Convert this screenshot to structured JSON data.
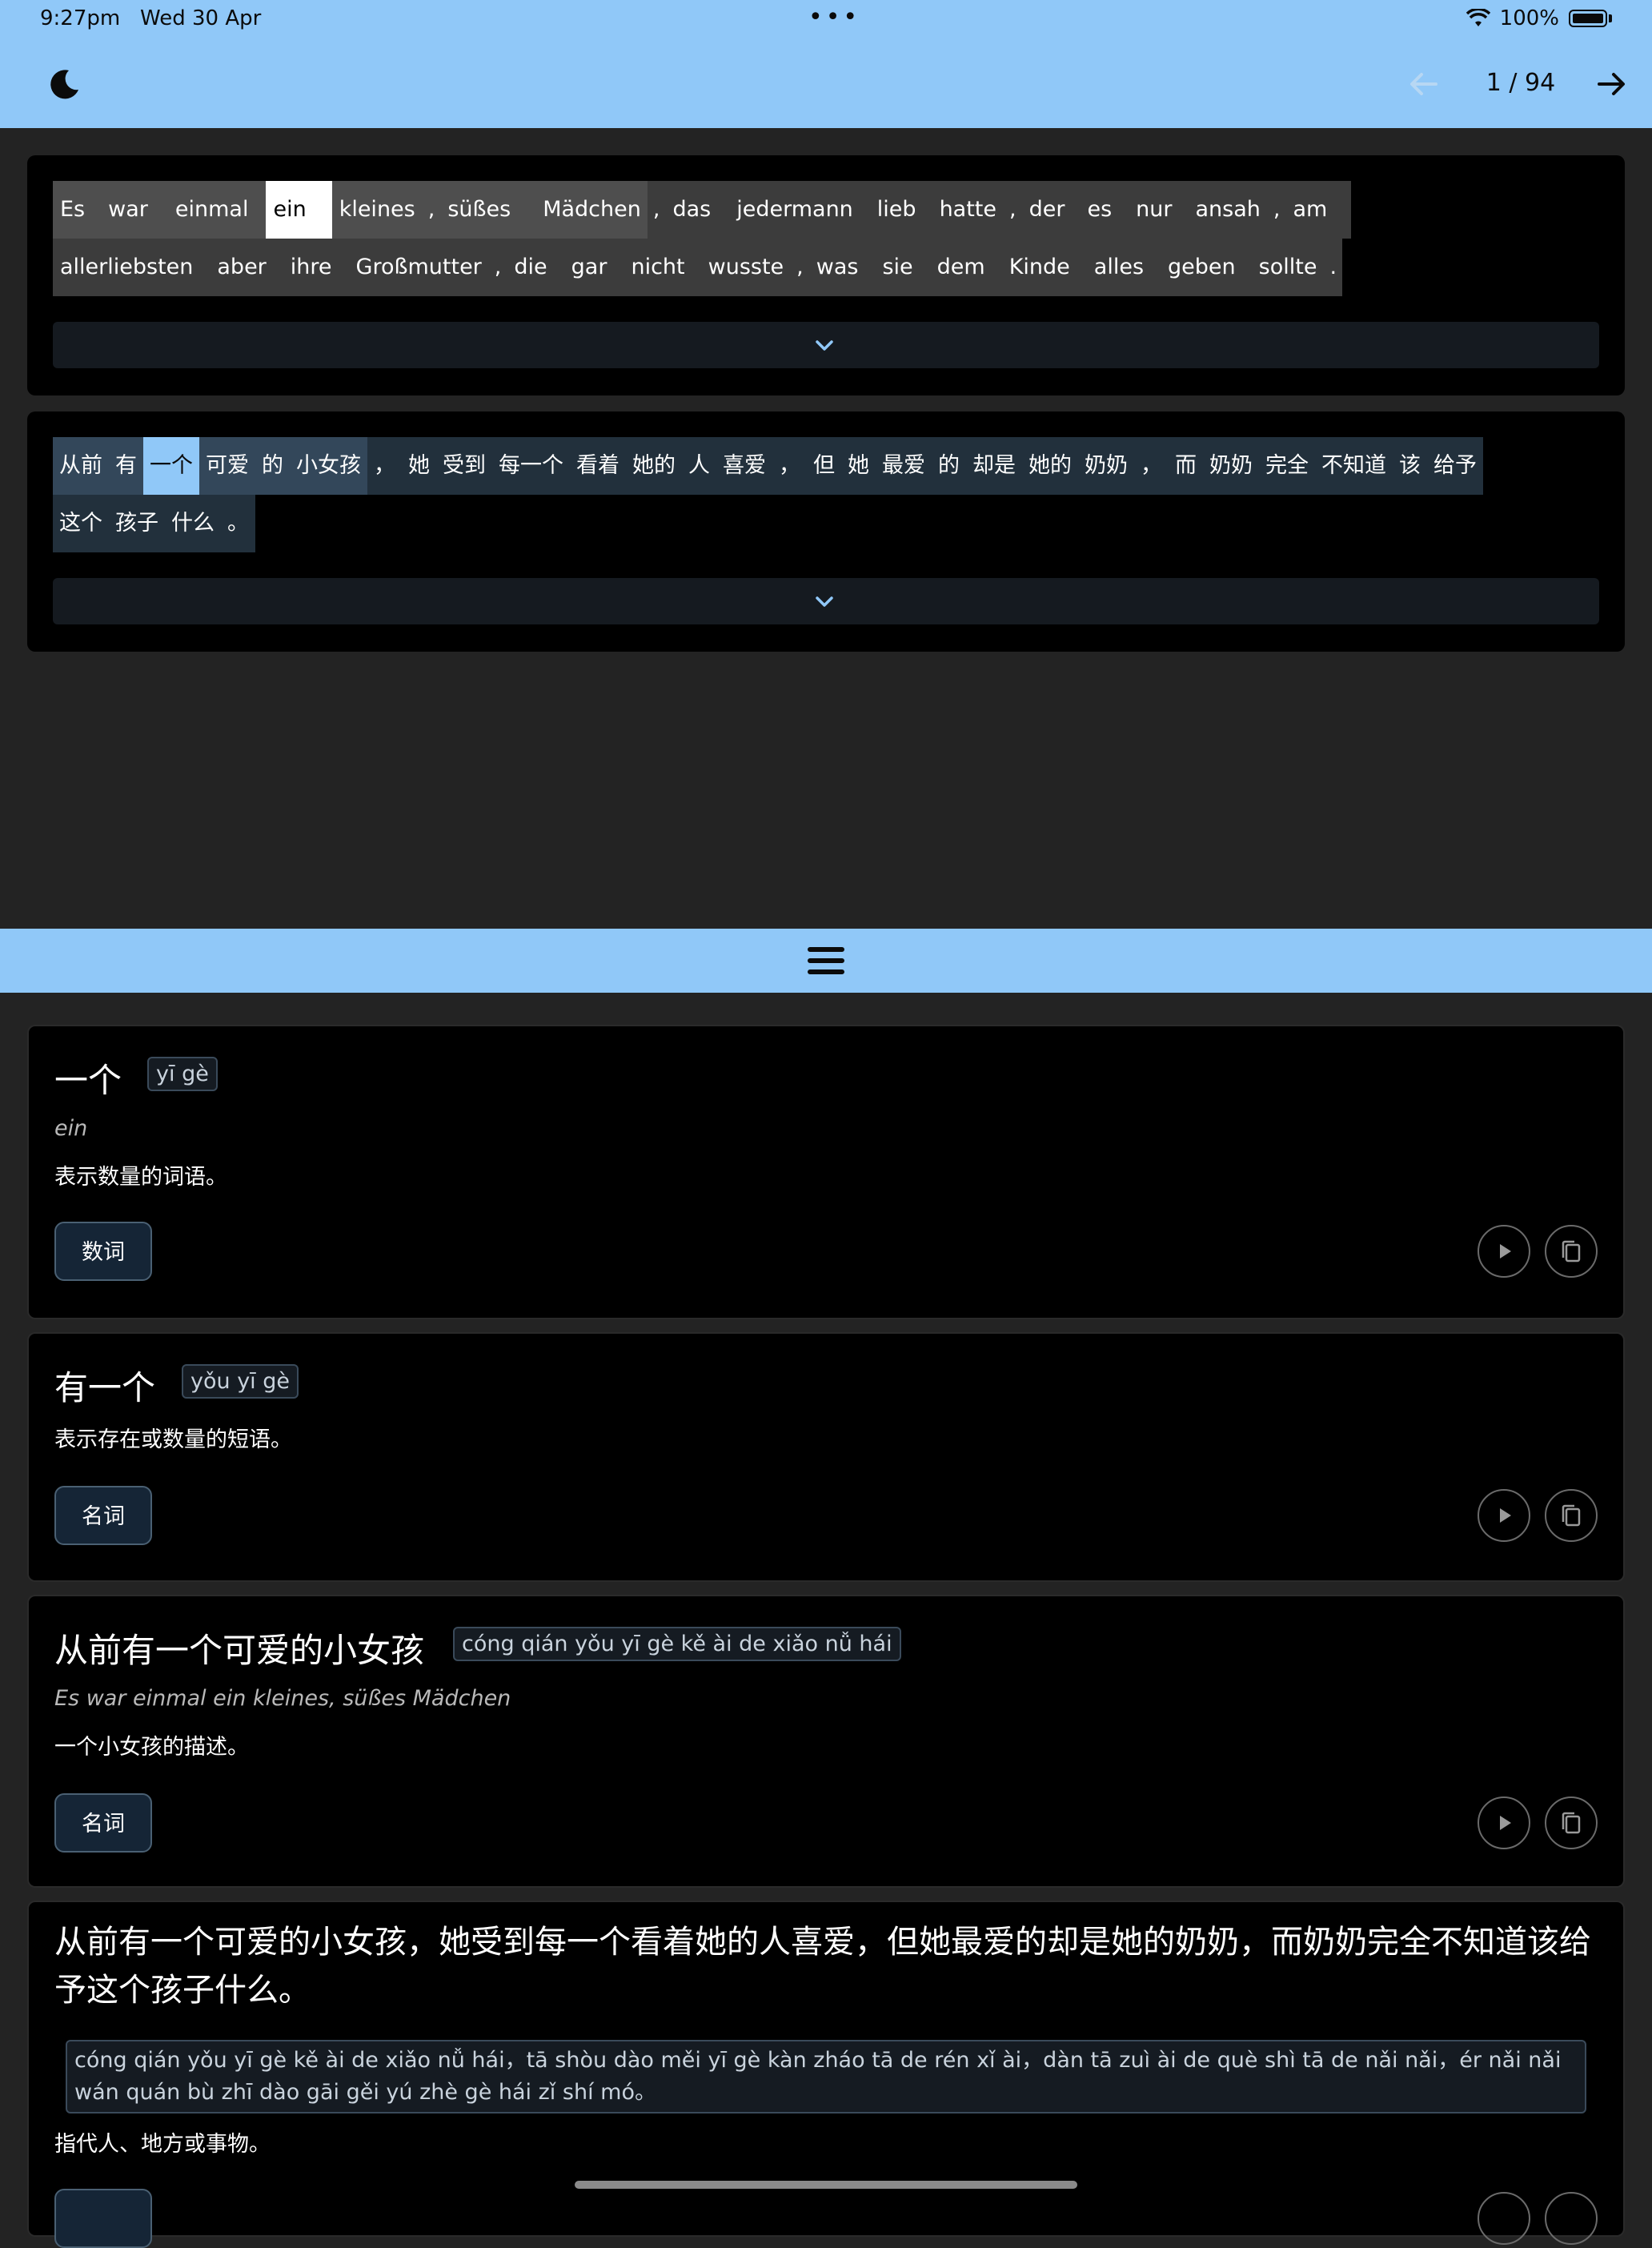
{
  "status_bar": {
    "time": "9:27pm",
    "date": "Wed 30 Apr",
    "battery": "100%"
  },
  "header": {
    "page_indicator": "1 / 94"
  },
  "german_sentence": {
    "row1": [
      "Es",
      "war",
      "einmal",
      "ein",
      "kleines",
      ",",
      "süßes",
      "Mädchen",
      ",",
      "das",
      "jedermann",
      "lieb",
      "hatte",
      ",",
      "der",
      "es",
      "nur",
      "ansah",
      ",",
      "am"
    ],
    "row2": [
      "allerliebsten",
      "aber",
      "ihre",
      "Großmutter",
      ",",
      "die",
      "gar",
      "nicht",
      "wusste",
      ",",
      "was",
      "sie",
      "dem",
      "Kinde",
      "alles",
      "geben",
      "sollte",
      "."
    ]
  },
  "chinese_sentence": {
    "row1": [
      "从前",
      "有",
      "一个",
      "可爱",
      "的",
      "小女孩",
      "，",
      "她",
      "受到",
      "每一个",
      "看着",
      "她的",
      "人",
      "喜爱",
      "，",
      "但",
      "她",
      "最爱",
      "的",
      "却是",
      "她的",
      "奶奶",
      "，",
      "而",
      "奶奶",
      "完全",
      "不知道",
      "该",
      "给予"
    ],
    "row2": [
      "这个",
      "孩子",
      "什么",
      "。"
    ]
  },
  "entries": [
    {
      "headword": "一个",
      "pinyin": "yī gè",
      "translation": "ein",
      "definition": "表示数量的词语。",
      "pos": "数词"
    },
    {
      "headword": "有一个",
      "pinyin": "yǒu yī gè",
      "definition": "表示存在或数量的短语。",
      "pos": "名词"
    },
    {
      "headword": "从前有一个可爱的小女孩",
      "pinyin": "cóng qián yǒu yī gè kě ài de xiǎo nǚ hái",
      "translation": "Es war einmal ein kleines, süßes Mädchen",
      "definition": "一个小女孩的描述。",
      "pos": "名词"
    },
    {
      "headword": "从前有一个可爱的小女孩，她受到每一个看着她的人喜爱，但她最爱的却是她的奶奶，而奶奶完全不知道该给予这个孩子什么。",
      "pinyin": "cóng qián yǒu yī gè kě ài de xiǎo nǚ hái，tā shòu dào měi yī gè kàn zháo tā de rén xǐ ài，dàn tā zuì ài de què shì tā de nǎi nǎi，ér nǎi nǎi wán quán bù zhī dào gāi gěi yú zhè gè hái zǐ shí mó。",
      "definition": "指代人、地方或事物。"
    }
  ],
  "icons": [
    "moon-icon",
    "arrow-left-icon",
    "arrow-right-icon",
    "chevron-down-icon",
    "hamburger-icon",
    "play-icon",
    "copy-icon",
    "wifi-icon",
    "battery-icon"
  ],
  "colors": {
    "accent": "#90c8f8",
    "background": "#232323",
    "card": "#000000"
  }
}
